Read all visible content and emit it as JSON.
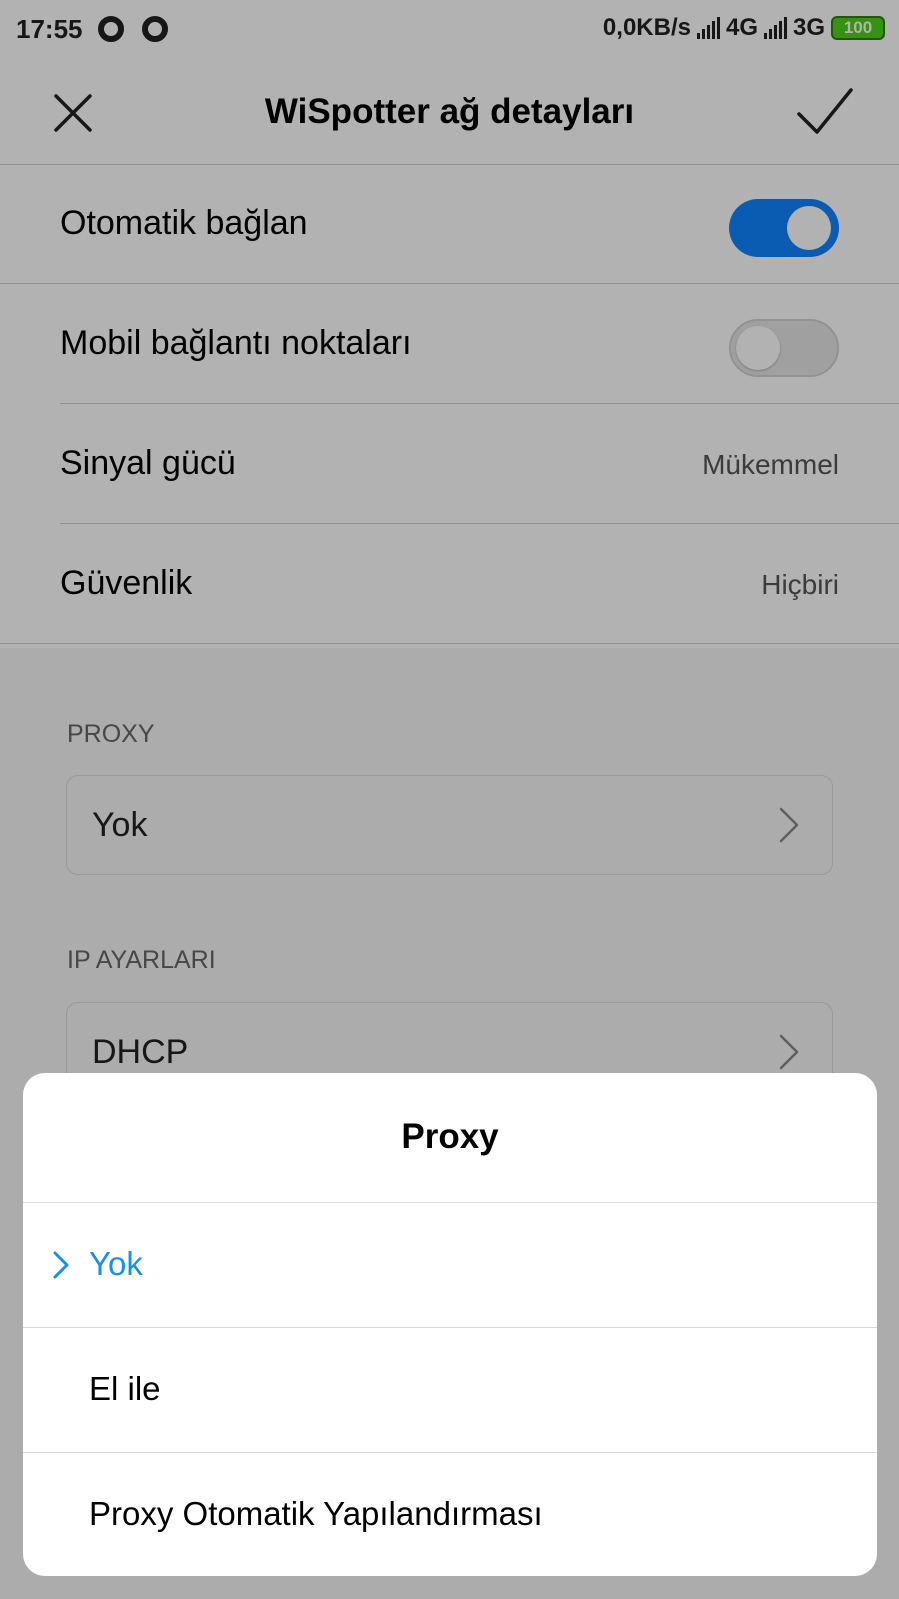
{
  "status_bar": {
    "time": "17:55",
    "network_speed": "0,0KB/s",
    "net1": "4G",
    "net2": "3G",
    "battery": "100"
  },
  "header": {
    "title": "WiSpotter ağ detayları",
    "close_icon": "close-icon",
    "confirm_icon": "check-icon"
  },
  "settings": {
    "auto_connect": {
      "label": "Otomatik bağlan",
      "enabled": true
    },
    "mobile_hotspots": {
      "label": "Mobil bağlantı noktaları",
      "enabled": false
    },
    "signal": {
      "label": "Sinyal gücü",
      "value": "Mükemmel"
    },
    "security": {
      "label": "Güvenlik",
      "value": "Hiçbiri"
    }
  },
  "proxy_section": {
    "title": "PROXY",
    "value": "Yok"
  },
  "ip_section": {
    "title": "IP AYARLARI",
    "value": "DHCP"
  },
  "sheet": {
    "title": "Proxy",
    "options": [
      {
        "label": "Yok",
        "selected": true
      },
      {
        "label": "El ile",
        "selected": false
      },
      {
        "label": "Proxy Otomatik Yapılandırması",
        "selected": false
      }
    ]
  },
  "colors": {
    "accent": "#0d84ff",
    "selected_text": "#1a8fe3",
    "battery": "#4cd11a"
  }
}
